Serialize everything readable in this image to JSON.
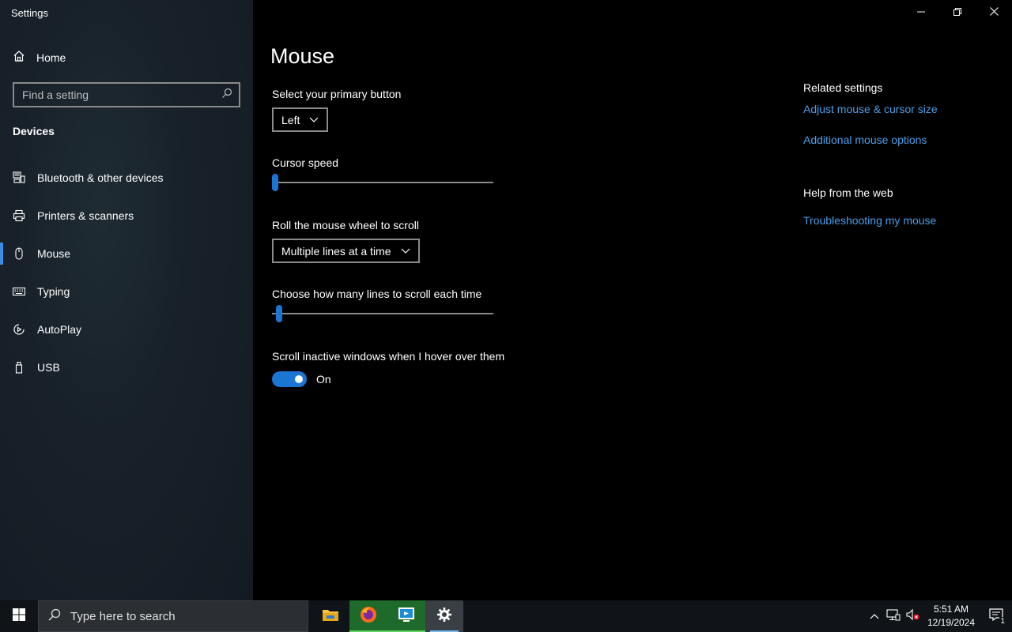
{
  "window": {
    "app_title": "Settings"
  },
  "sidebar": {
    "home_label": "Home",
    "search_placeholder": "Find a setting",
    "section_heading": "Devices",
    "items": [
      {
        "label": "Bluetooth & other devices",
        "icon": "bluetooth-devices-icon",
        "active": false
      },
      {
        "label": "Printers & scanners",
        "icon": "printer-icon",
        "active": false
      },
      {
        "label": "Mouse",
        "icon": "mouse-icon",
        "active": true
      },
      {
        "label": "Typing",
        "icon": "keyboard-icon",
        "active": false
      },
      {
        "label": "AutoPlay",
        "icon": "autoplay-icon",
        "active": false
      },
      {
        "label": "USB",
        "icon": "usb-icon",
        "active": false
      }
    ]
  },
  "main": {
    "title": "Mouse",
    "primary_button": {
      "label": "Select your primary button",
      "value": "Left"
    },
    "cursor_speed": {
      "label": "Cursor speed",
      "value_fraction": 0.0
    },
    "wheel_scroll": {
      "label": "Roll the mouse wheel to scroll",
      "value": "Multiple lines at a time"
    },
    "lines_to_scroll": {
      "label": "Choose how many lines to scroll each time",
      "value_fraction": 0.02
    },
    "scroll_inactive": {
      "label": "Scroll inactive windows when I hover over them",
      "state": "On"
    }
  },
  "related": {
    "heading": "Related settings",
    "links": [
      "Adjust mouse & cursor size",
      "Additional mouse options"
    ],
    "help_heading": "Help from the web",
    "help_links": [
      "Troubleshooting my mouse"
    ]
  },
  "taskbar": {
    "search_placeholder": "Type here to search",
    "time": "5:51 AM",
    "date": "12/19/2024",
    "notification_count": "1"
  },
  "colors": {
    "accent": "#1a76d2",
    "link": "#4a9fe8"
  }
}
